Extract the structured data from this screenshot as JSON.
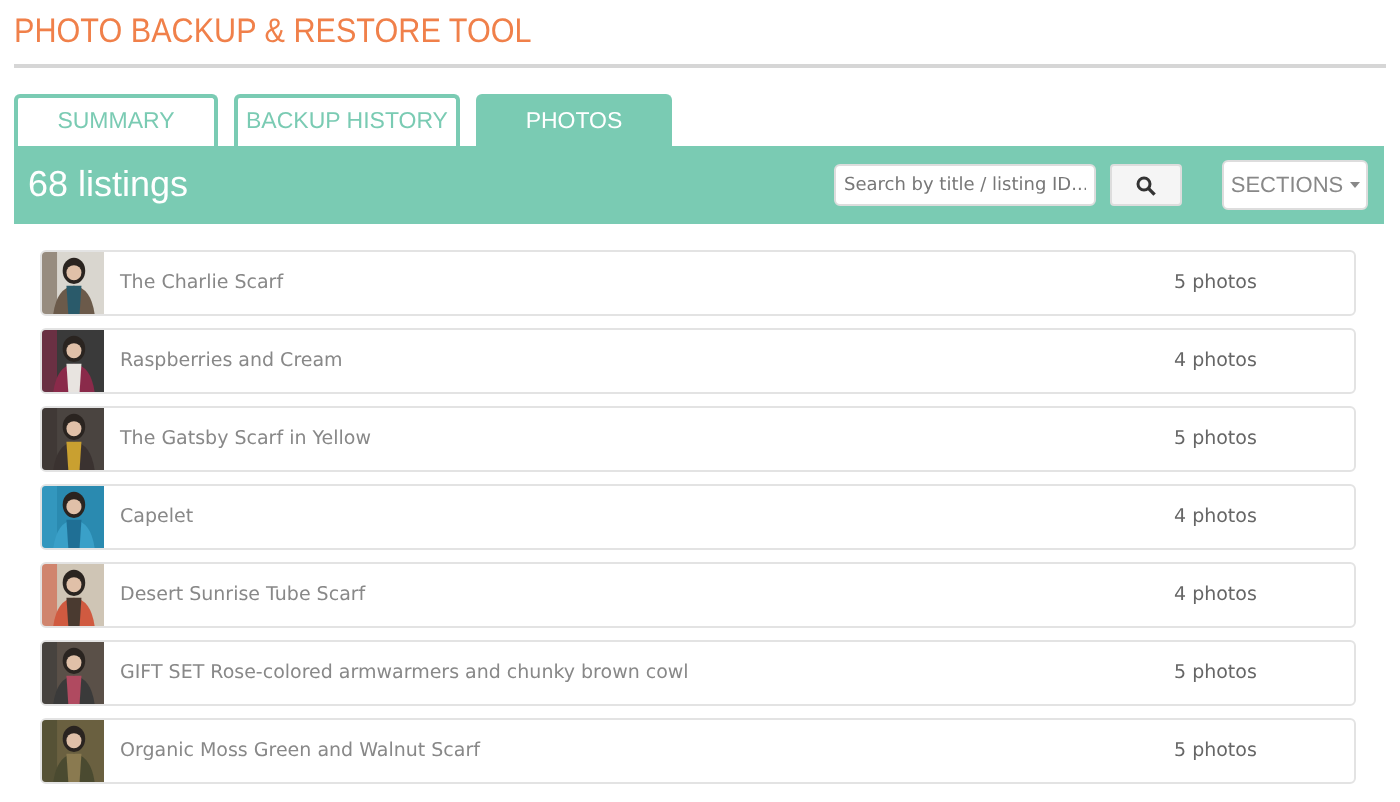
{
  "title": "PHOTO BACKUP & RESTORE TOOL",
  "tabs": [
    {
      "label": "SUMMARY",
      "selected": false
    },
    {
      "label": "BACKUP HISTORY",
      "selected": false
    },
    {
      "label": "PHOTOS",
      "selected": true
    }
  ],
  "toolbar": {
    "count": "68 listings",
    "search": {
      "placeholder": "Search by title / listing ID..."
    },
    "sections_button": "SECTIONS"
  },
  "listings": [
    {
      "title": "The Charlie Scarf",
      "photos": "5 photos"
    },
    {
      "title": "Raspberries and Cream",
      "photos": "4 photos"
    },
    {
      "title": "The Gatsby Scarf in Yellow",
      "photos": "5 photos"
    },
    {
      "title": "Capelet",
      "photos": "4 photos"
    },
    {
      "title": "Desert Sunrise Tube Scarf",
      "photos": "4 photos"
    },
    {
      "title": "GIFT SET Rose-colored armwarmers and chunky brown cowl",
      "photos": "5 photos"
    },
    {
      "title": "Organic Moss Green and Walnut Scarf",
      "photos": "5 photos"
    }
  ]
}
